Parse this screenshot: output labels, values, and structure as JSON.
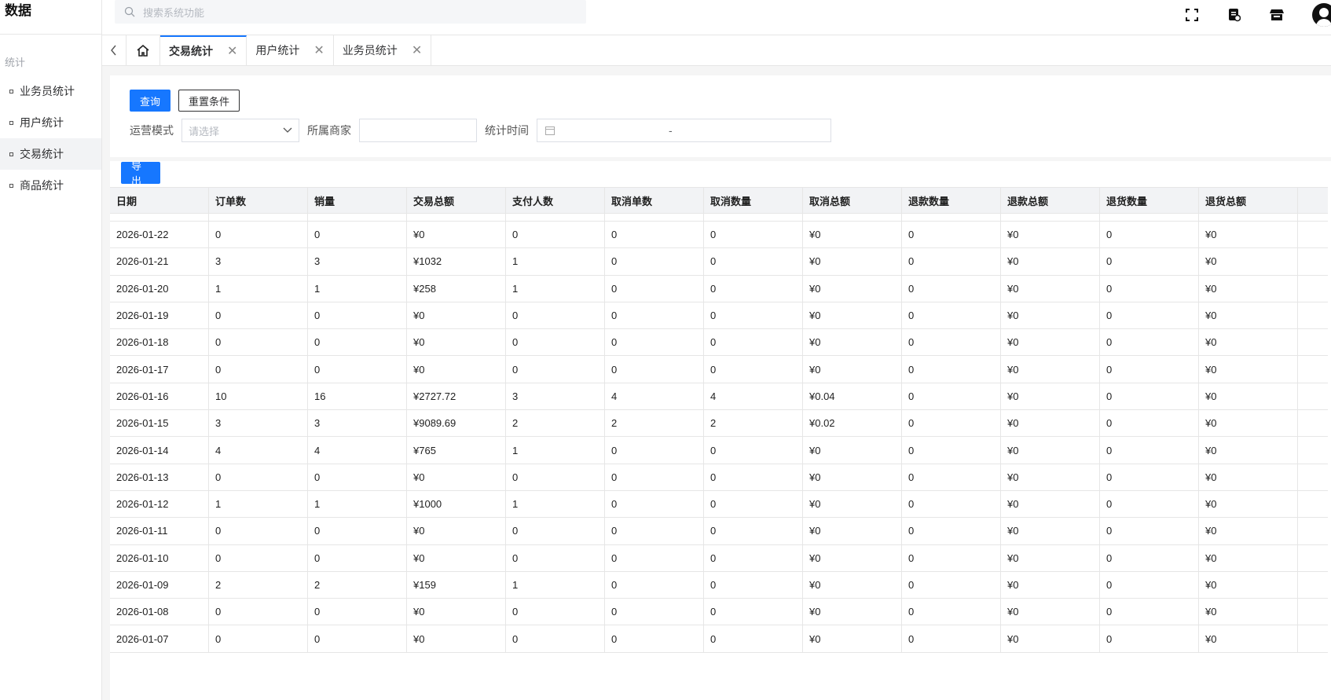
{
  "sidebar": {
    "brand": "数据",
    "section_title": "统计",
    "items": [
      {
        "label": "业务员统计",
        "active": false
      },
      {
        "label": "用户统计",
        "active": false
      },
      {
        "label": "交易统计",
        "active": true
      },
      {
        "label": "商品统计",
        "active": false
      }
    ]
  },
  "header": {
    "search_placeholder": "搜索系统功能",
    "icons": [
      "fullscreen-icon",
      "document-icon",
      "store-icon",
      "user-avatar"
    ]
  },
  "tabs": [
    {
      "label": "交易统计",
      "active": true
    },
    {
      "label": "用户统计",
      "active": false
    },
    {
      "label": "业务员统计",
      "active": false
    }
  ],
  "toolbar": {
    "query_label": "查询",
    "reset_label": "重置条件",
    "export_label": "导出"
  },
  "filters": {
    "mode_label": "运营模式",
    "mode_placeholder": "请选择",
    "merchant_label": "所属商家",
    "time_label": "统计时间",
    "date_separator": "-"
  },
  "table": {
    "columns": [
      "日期",
      "订单数",
      "销量",
      "交易总额",
      "支付人数",
      "取消单数",
      "取消数量",
      "取消总额",
      "退款数量",
      "退款总额",
      "退货数量",
      "退货总额"
    ],
    "rows": [
      [
        "2026-01-22",
        "0",
        "0",
        "¥0",
        "0",
        "0",
        "0",
        "¥0",
        "0",
        "¥0",
        "0",
        "¥0"
      ],
      [
        "2026-01-21",
        "3",
        "3",
        "¥1032",
        "1",
        "0",
        "0",
        "¥0",
        "0",
        "¥0",
        "0",
        "¥0"
      ],
      [
        "2026-01-20",
        "1",
        "1",
        "¥258",
        "1",
        "0",
        "0",
        "¥0",
        "0",
        "¥0",
        "0",
        "¥0"
      ],
      [
        "2026-01-19",
        "0",
        "0",
        "¥0",
        "0",
        "0",
        "0",
        "¥0",
        "0",
        "¥0",
        "0",
        "¥0"
      ],
      [
        "2026-01-18",
        "0",
        "0",
        "¥0",
        "0",
        "0",
        "0",
        "¥0",
        "0",
        "¥0",
        "0",
        "¥0"
      ],
      [
        "2026-01-17",
        "0",
        "0",
        "¥0",
        "0",
        "0",
        "0",
        "¥0",
        "0",
        "¥0",
        "0",
        "¥0"
      ],
      [
        "2026-01-16",
        "10",
        "16",
        "¥2727.72",
        "3",
        "4",
        "4",
        "¥0.04",
        "0",
        "¥0",
        "0",
        "¥0"
      ],
      [
        "2026-01-15",
        "3",
        "3",
        "¥9089.69",
        "2",
        "2",
        "2",
        "¥0.02",
        "0",
        "¥0",
        "0",
        "¥0"
      ],
      [
        "2026-01-14",
        "4",
        "4",
        "¥765",
        "1",
        "0",
        "0",
        "¥0",
        "0",
        "¥0",
        "0",
        "¥0"
      ],
      [
        "2026-01-13",
        "0",
        "0",
        "¥0",
        "0",
        "0",
        "0",
        "¥0",
        "0",
        "¥0",
        "0",
        "¥0"
      ],
      [
        "2026-01-12",
        "1",
        "1",
        "¥1000",
        "1",
        "0",
        "0",
        "¥0",
        "0",
        "¥0",
        "0",
        "¥0"
      ],
      [
        "2026-01-11",
        "0",
        "0",
        "¥0",
        "0",
        "0",
        "0",
        "¥0",
        "0",
        "¥0",
        "0",
        "¥0"
      ],
      [
        "2026-01-10",
        "0",
        "0",
        "¥0",
        "0",
        "0",
        "0",
        "¥0",
        "0",
        "¥0",
        "0",
        "¥0"
      ],
      [
        "2026-01-09",
        "2",
        "2",
        "¥159",
        "1",
        "0",
        "0",
        "¥0",
        "0",
        "¥0",
        "0",
        "¥0"
      ],
      [
        "2026-01-08",
        "0",
        "0",
        "¥0",
        "0",
        "0",
        "0",
        "¥0",
        "0",
        "¥0",
        "0",
        "¥0"
      ],
      [
        "2026-01-07",
        "0",
        "0",
        "¥0",
        "0",
        "0",
        "0",
        "¥0",
        "0",
        "¥0",
        "0",
        "¥0"
      ]
    ]
  },
  "colors": {
    "primary": "#1677ff",
    "header_bg": "#f2f3f5",
    "border": "#e6e6e6"
  }
}
